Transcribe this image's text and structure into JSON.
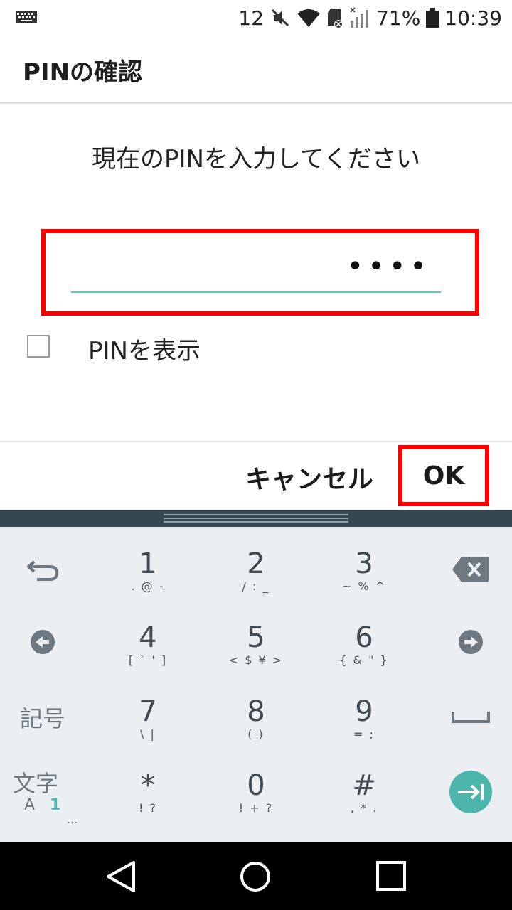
{
  "status_bar": {
    "notification_count": "12",
    "battery": "71%",
    "time": "10:39",
    "icons": [
      "keyboard-icon",
      "mute-icon",
      "wifi-icon",
      "sd-card-icon",
      "signal-icon",
      "battery-icon"
    ]
  },
  "dialog": {
    "title": "PINの確認",
    "prompt": "現在のPINを入力してください",
    "pin_value": "••••",
    "show_pin_label": "PINを表示",
    "show_pin_checked": false,
    "cancel_label": "キャンセル",
    "ok_label": "OK",
    "accent_color": "#5ec9b6",
    "highlight_color": "#ff0000"
  },
  "keyboard": {
    "keys": [
      {
        "main": "1",
        "sub": ". @ -"
      },
      {
        "main": "2",
        "sub": "/ : _"
      },
      {
        "main": "3",
        "sub": "~ % ^"
      },
      {
        "main": "4",
        "sub": "[ ` ' ]"
      },
      {
        "main": "5",
        "sub": "< $ ¥ >"
      },
      {
        "main": "6",
        "sub": "{ & \" }"
      },
      {
        "main": "7",
        "sub": "\\   |"
      },
      {
        "main": "8",
        "sub": "(    )"
      },
      {
        "main": "9",
        "sub": "=    ;"
      },
      {
        "main": "*",
        "sub": "!    ?"
      },
      {
        "main": "0",
        "sub": "! + ?"
      },
      {
        "main": "#",
        "sub": ", * ."
      }
    ],
    "symbols_label": "記号",
    "mode_label": "文字",
    "mode_sub_a": "A",
    "mode_sub_1": "1",
    "mode_more": "...",
    "enter_color": "#4db6ac"
  }
}
